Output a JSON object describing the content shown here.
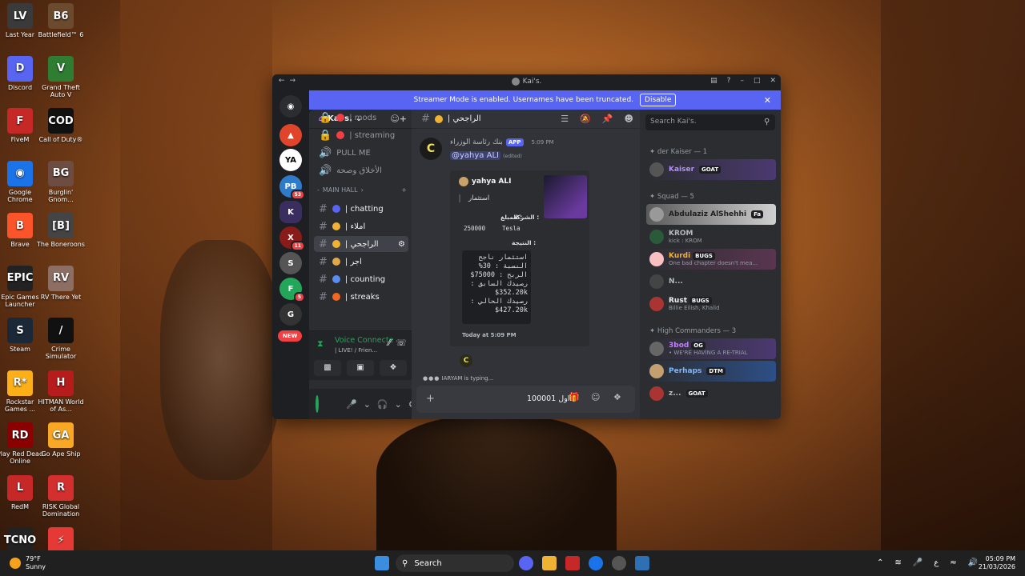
{
  "desktop": {
    "icons": [
      {
        "label": "Last Year",
        "glyph": "LV",
        "color": "#3a3a3a"
      },
      {
        "label": "Battlefield™ 6",
        "glyph": "B6",
        "color": "#6b4a2e"
      },
      {
        "label": "Discord",
        "glyph": "D",
        "color": "#5865f2"
      },
      {
        "label": "Grand Theft Auto V",
        "glyph": "V",
        "color": "#2e7d32"
      },
      {
        "label": "FiveM",
        "glyph": "F",
        "color": "#c62828"
      },
      {
        "label": "Call of Duty®",
        "glyph": "COD",
        "color": "#111111"
      },
      {
        "label": "Google Chrome",
        "glyph": "◉",
        "color": "#1a73e8"
      },
      {
        "label": "Burglin' Gnom...",
        "glyph": "BG",
        "color": "#6d4c41"
      },
      {
        "label": "Brave",
        "glyph": "B",
        "color": "#fb542b"
      },
      {
        "label": "The Boneroons",
        "glyph": "[B]",
        "color": "#444444"
      },
      {
        "label": "Epic Games Launcher",
        "glyph": "EPIC",
        "color": "#222222"
      },
      {
        "label": "RV There Yet",
        "glyph": "RV",
        "color": "#8d6e63"
      },
      {
        "label": "Steam",
        "glyph": "S",
        "color": "#1b2838"
      },
      {
        "label": "Crime Simulator",
        "glyph": "/",
        "color": "#111111"
      },
      {
        "label": "Rockstar Games ...",
        "glyph": "R*",
        "color": "#fcaf17"
      },
      {
        "label": "HITMAN World of As...",
        "glyph": "H",
        "color": "#b71c1c"
      },
      {
        "label": "Play Red Dead Online",
        "glyph": "RD",
        "color": "#8b0000"
      },
      {
        "label": "Go Ape Ship",
        "glyph": "GA",
        "color": "#f9a825"
      },
      {
        "label": "RedM",
        "glyph": "L",
        "color": "#c62828"
      },
      {
        "label": "RISK Global Domination",
        "glyph": "R",
        "color": "#d32f2f"
      },
      {
        "label": "",
        "glyph": "TCNO",
        "color": "#222222"
      },
      {
        "label": "",
        "glyph": "⚡",
        "color": "#e53935"
      }
    ]
  },
  "window": {
    "title": "Kai's.",
    "banner_text": "Streamer Mode is enabled. Usernames have been truncated.",
    "banner_button": "Disable"
  },
  "servers": {
    "badges": [
      "53",
      "11",
      "5"
    ],
    "new_label": "NEW"
  },
  "server_name": "Kai's.",
  "channels": [
    {
      "name": "| mods",
      "icon": "#",
      "active": false
    },
    {
      "name": "| streaming",
      "icon": "#",
      "active": false
    },
    {
      "name": "PULL ME",
      "icon": "🔊",
      "active": false
    },
    {
      "name": "الأخلاق وصحة",
      "icon": "🔊",
      "active": false
    }
  ],
  "category": "MAIN HALL",
  "main_channels": [
    {
      "name": "| chatting",
      "active": false
    },
    {
      "name": "| املاء",
      "active": false
    },
    {
      "name": "| الراجحي",
      "active": true
    },
    {
      "name": "| اجر",
      "active": false
    },
    {
      "name": "| counting",
      "active": false
    },
    {
      "name": "| streaks",
      "active": false
    }
  ],
  "voice": {
    "status": "Voice Connecte",
    "detail": "| LIVE! / Frien..."
  },
  "chat": {
    "channel": "| الراجحي",
    "message": {
      "author": "بنك رئاسة الوزراء",
      "app_tag": "APP",
      "time": "5:09 PM",
      "mention": "@yahya ALI",
      "edited": "(edited)",
      "embed_author": "yahya ALI",
      "embed_title": "استثمار",
      "field1_label": "المبلغ :",
      "field1_value": "250000",
      "field2_label": "الشركة :",
      "field2_value": "Tesla",
      "field3_label": "النتيجة :",
      "code_lines": [
        "استثمار ناجح",
        "النسبة : 30%",
        "الربح : 75000$",
        "رصيدك السابق :",
        "$352.20k",
        "رصيدك الحالي :",
        "$427.20k"
      ],
      "footer": "Today at 5:09 PM"
    },
    "typing": "IARYAM is typing...",
    "input_value": "100001 تداول",
    "search_placeholder": "Search Kai's."
  },
  "members": {
    "groups": [
      {
        "title": "der Kaiser — 1"
      },
      {
        "title": "Squad — 5"
      },
      {
        "title": "High Commanders — 3"
      }
    ],
    "list": [
      {
        "name": "Kaiser",
        "tag": "GOAT",
        "sub": "",
        "color": "#b58cff",
        "bg": "#4b3970"
      },
      {
        "name": "Abdulaziz AlShehhi",
        "tag": "Fa",
        "sub": "",
        "color": "#1e1f22",
        "bg": "#c9c9c9"
      },
      {
        "name": "KROM",
        "tag": "",
        "sub": "kick : KROM",
        "color": "#b5bac1",
        "bg": ""
      },
      {
        "name": "Kurdi",
        "tag": "BUGS",
        "sub": "One bad chapter doesn't mea...",
        "color": "#f0b232",
        "bg": "#5a3550"
      },
      {
        "name": "N...",
        "tag": "",
        "sub": "",
        "color": "#b5bac1",
        "bg": ""
      },
      {
        "name": "Rust",
        "tag": "BUGS",
        "sub": "Billie Eilish, Khalid",
        "color": "#f2f3f5",
        "bg": ""
      },
      {
        "name": "3bod",
        "tag": "OG",
        "sub": "• WE'RE HAVING A RE-TRIAL",
        "color": "#c27cff",
        "bg": "#4b3970"
      },
      {
        "name": "Perhaps",
        "tag": "DTM",
        "sub": "",
        "color": "#7ab8ff",
        "bg": "#2d4f86"
      },
      {
        "name": "z...",
        "tag": "GOAT",
        "sub": "",
        "color": "#b5bac1",
        "bg": ""
      }
    ]
  },
  "taskbar": {
    "weather_temp": "79°F",
    "weather_desc": "Sunny",
    "search": "Search",
    "time": "05:09 PM",
    "date": "21/03/2026",
    "lang": "ع"
  }
}
